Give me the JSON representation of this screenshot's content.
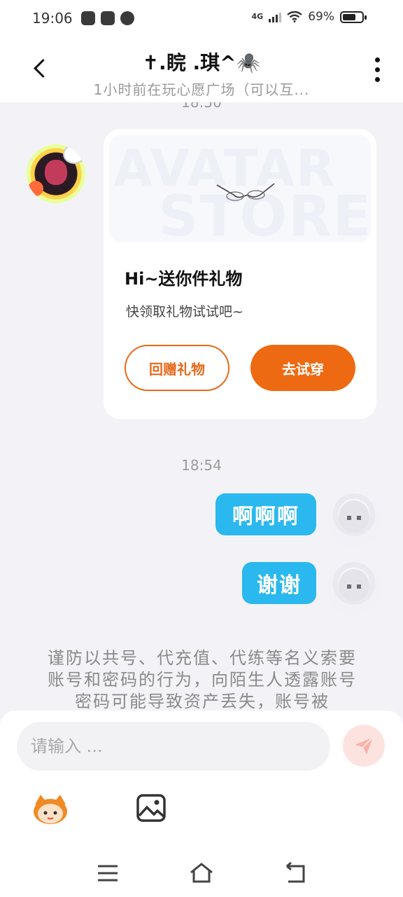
{
  "status_bar": {
    "time": "19:06",
    "network": "4G",
    "battery_percent": "69%",
    "battery_level": 0.69,
    "icons_left": [
      "link-icon",
      "play-icon",
      "fan-icon"
    ]
  },
  "header": {
    "title": "✝.睆 .琪^🕷️",
    "subtitle": "1小时前在玩心愿广场（可以互...",
    "back_icon": "back-arrow-icon",
    "more_icon": "more-vertical-icon"
  },
  "timestamps": {
    "top_partial": "18:50",
    "second": "18:54"
  },
  "gift_card": {
    "banner_watermark_1": "AVATAR",
    "banner_watermark_2": "STORE",
    "title": "Hi~送你件礼物",
    "description": "快领取礼物试试吧~",
    "return_gift_label": "回赠礼物",
    "try_on_label": "去试穿"
  },
  "messages": [
    {
      "sender": "me",
      "text": "啊啊啊"
    },
    {
      "sender": "me",
      "text": "谢谢"
    }
  ],
  "notice": "谨防以共号、代充值、代练等名义索要账号和密码的行为，向陌生人透露账号密码可能导致资产丢失，账号被",
  "input": {
    "placeholder": "请输入 ...",
    "value": ""
  },
  "colors": {
    "accent_orange": "#ee6a12",
    "bubble_blue": "#2ab8ef",
    "background": "#f3f3f7"
  }
}
